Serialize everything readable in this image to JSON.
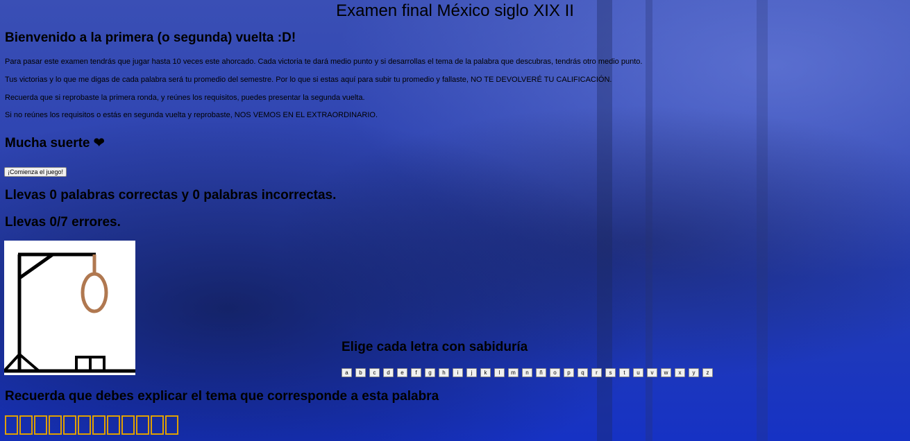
{
  "title": "Examen final México siglo XIX II",
  "welcome": "Bienvenido a la primera (o segunda) vuelta :D!",
  "paragraphs": [
    "Para pasar este examen tendrás que jugar hasta 10 veces este ahorcado. Cada victoria te dará medio punto y si desarrollas el tema de la palabra que descubras, tendrás otro medio punto.",
    "Tus victorias y lo que me digas de cada palabra será tu promedio del semestre. Por lo que si estas aquí para subir tu promedio y fallaste, NO TE DEVOLVERÉ TU CALIFICACIÓN.",
    "Recuerda que si reprobaste la primera ronda, y reúnes los requisitos, puedes presentar la segunda vuelta.",
    "Si no reúnes los requisitos o estás en segunda vuelta y reprobaste, NOS VEMOS EN EL EXTRAORDINARIO."
  ],
  "good_luck": "Mucha suerte ❤",
  "start_button": "¡Comienza el juego!",
  "score_text": "Llevas 0 palabras correctas y 0 palabras incorrectas.",
  "errors_text": "Llevas 0/7 errores.",
  "errors": {
    "current": 0,
    "max": 7
  },
  "letters_heading": "Elige cada letra con sabiduría",
  "letters": [
    "a",
    "b",
    "c",
    "d",
    "e",
    "f",
    "g",
    "h",
    "i",
    "j",
    "k",
    "l",
    "m",
    "n",
    "ñ",
    "o",
    "p",
    "q",
    "r",
    "s",
    "t",
    "u",
    "v",
    "w",
    "x",
    "y",
    "z"
  ],
  "reminder": "Recuerda que debes explicar el tema que corresponde a esta palabra",
  "word_length": 12,
  "colors": {
    "slot_border": "#e0a000",
    "rope": "#b07850",
    "background": "#2e44b2"
  }
}
